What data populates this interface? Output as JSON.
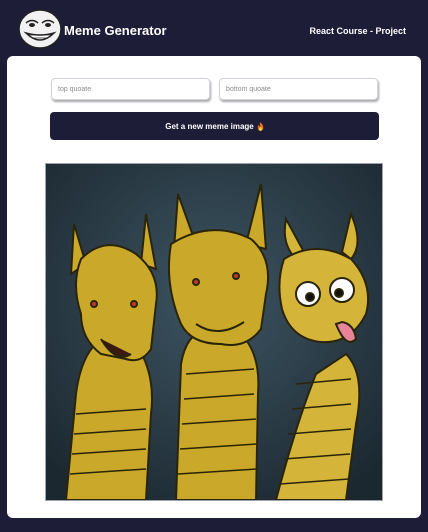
{
  "header": {
    "title": "Meme Generator",
    "subtitle": "React Course - Project",
    "logo_icon": "troll-face-icon"
  },
  "form": {
    "top_placeholder": "top quoate",
    "bottom_placeholder": "bottom quoate",
    "button_label": "Get a new meme image",
    "button_icon": "flame-icon"
  },
  "meme": {
    "image_name": "three-headed-dragon-meme",
    "top_text": "",
    "bottom_text": ""
  },
  "colors": {
    "brand": "#1e1d38",
    "card": "#ffffff",
    "dragon": "#c9a82a",
    "sky": "#2e3f4a"
  }
}
